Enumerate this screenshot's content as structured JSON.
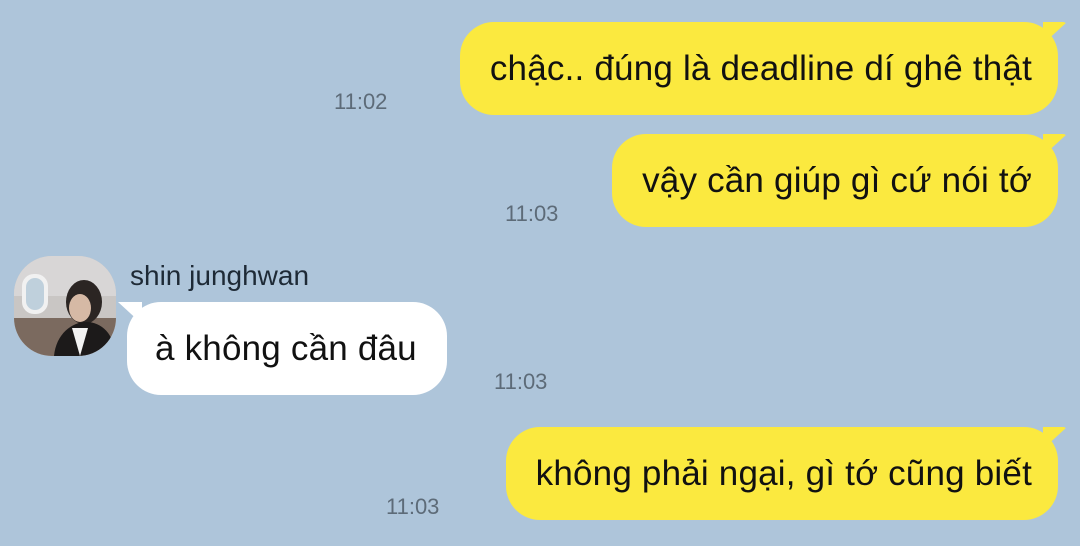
{
  "theme": {
    "background": "#aec5da",
    "sent_bubble": "#fbe93f",
    "received_bubble": "#ffffff",
    "timestamp_color": "#5d6b78"
  },
  "messages": [
    {
      "direction": "sent",
      "text": "chậc.. đúng là deadline dí ghê thật",
      "time": "11:02"
    },
    {
      "direction": "sent",
      "text": "vậy cần giúp gì cứ nói tớ",
      "time": "11:03"
    },
    {
      "direction": "received",
      "sender": "shin junghwan",
      "avatar": "profile-photo",
      "text": "à không cần đâu",
      "time": "11:03"
    },
    {
      "direction": "sent",
      "text": "không phải ngại, gì tớ cũng biết",
      "time": "11:03"
    }
  ]
}
